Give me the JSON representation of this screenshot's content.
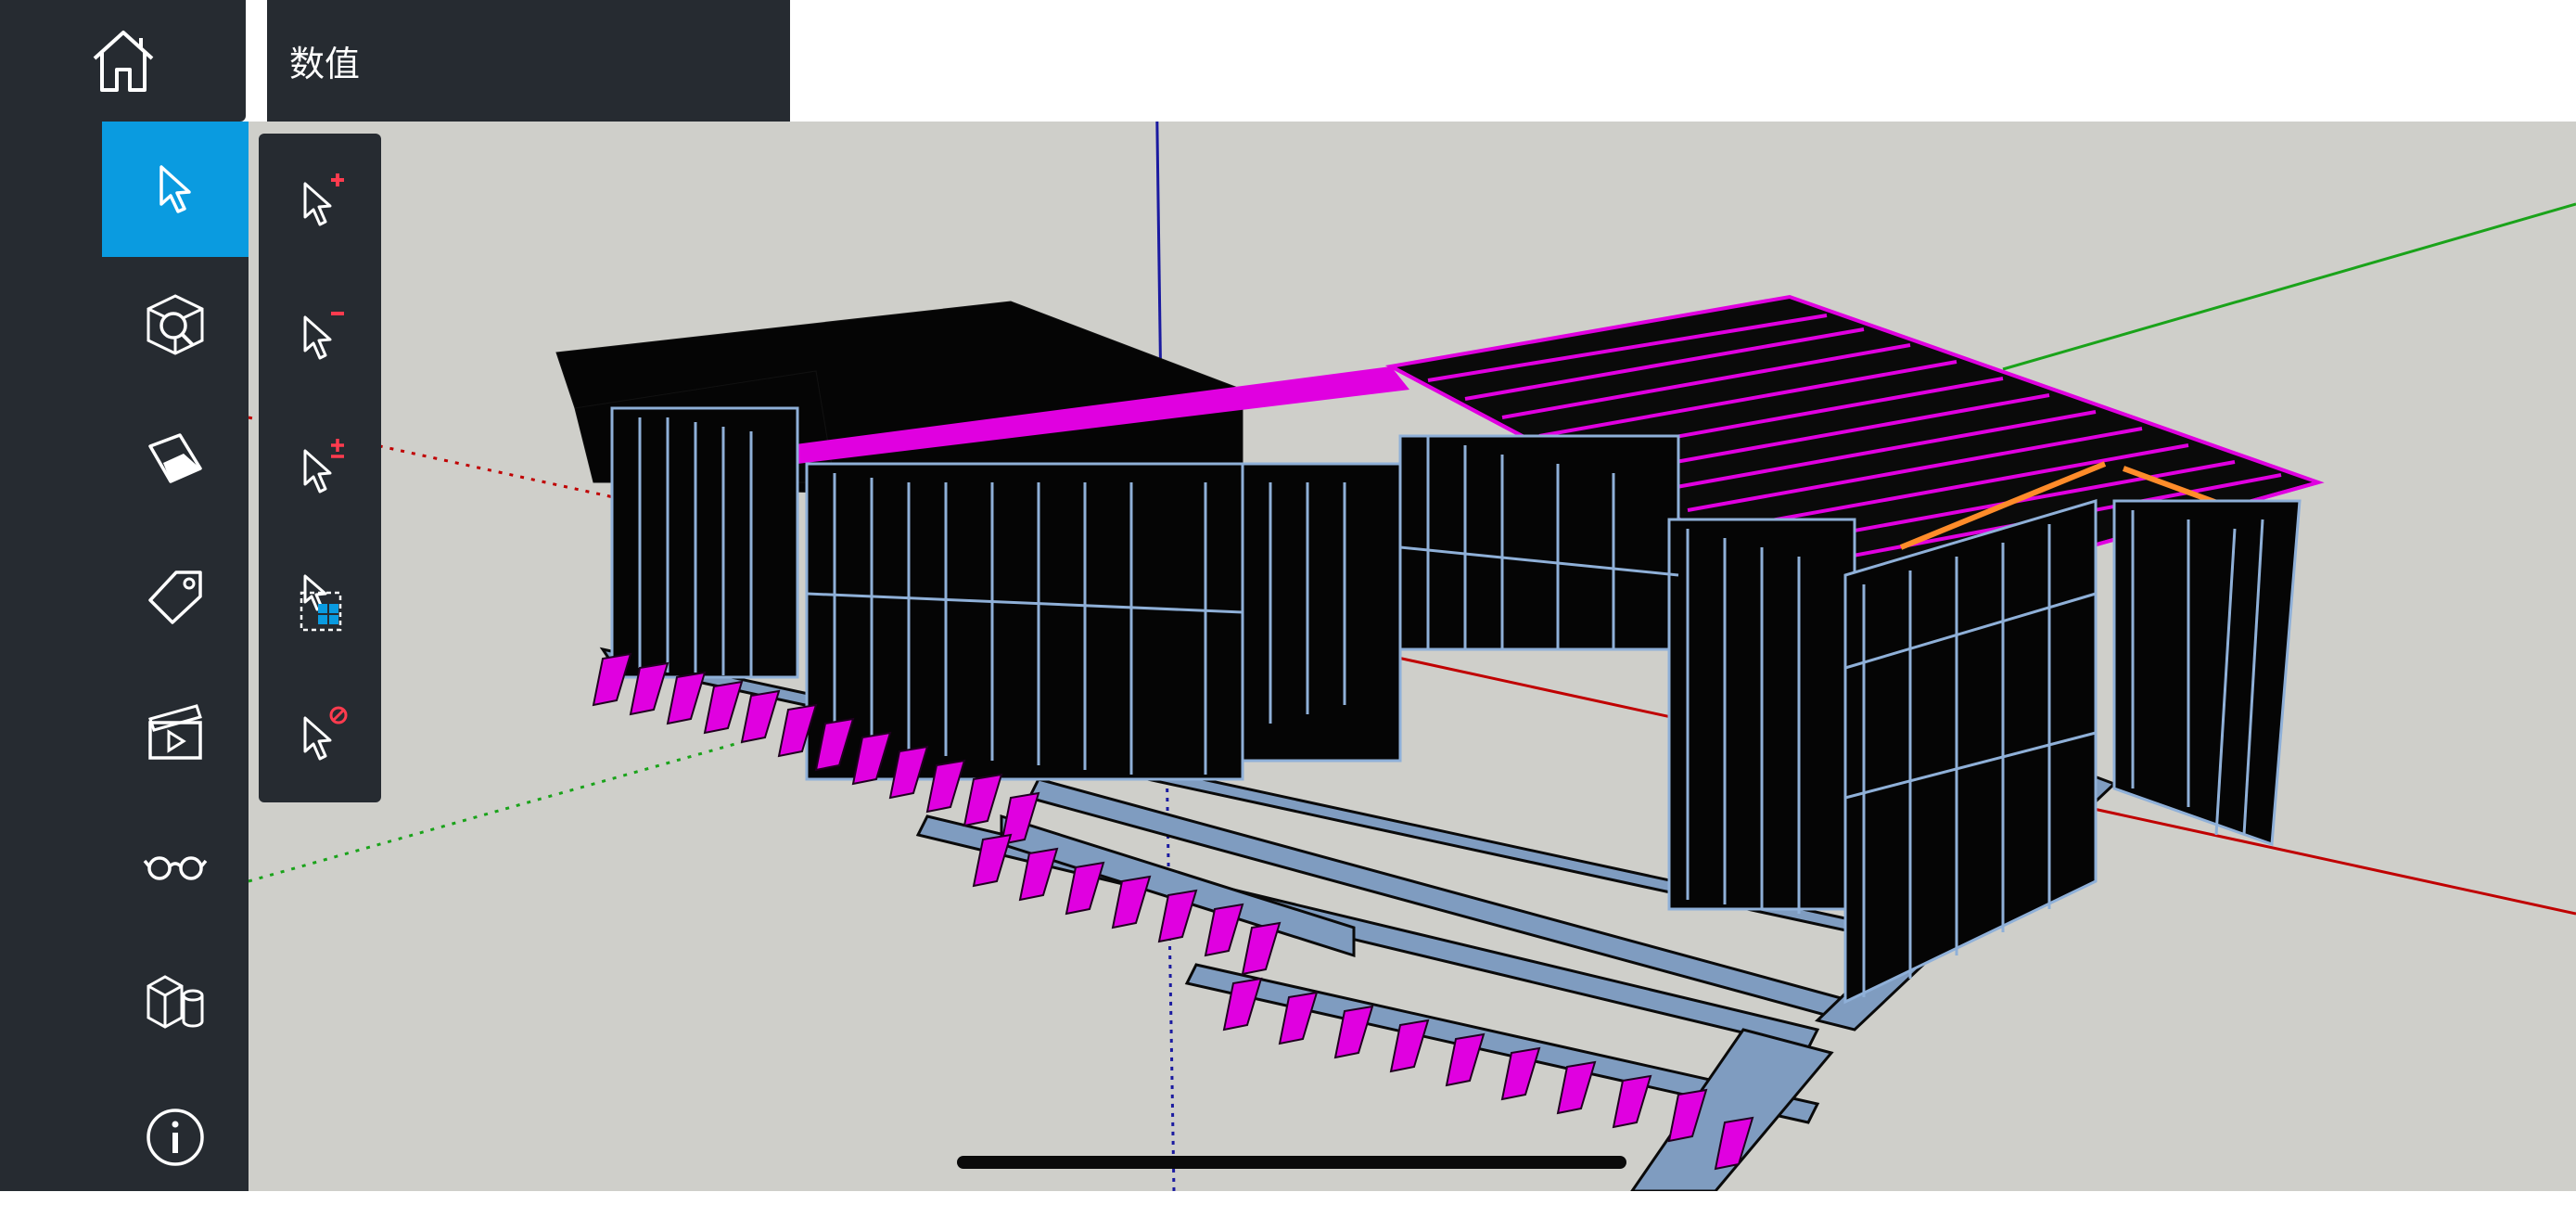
{
  "header": {
    "home_icon": "home-icon",
    "value_label": "数值"
  },
  "toolbar": {
    "tools": [
      {
        "id": "select",
        "icon": "select-arrow-icon",
        "active": true
      },
      {
        "id": "orbit",
        "icon": "search-model-icon",
        "active": false
      },
      {
        "id": "eraser",
        "icon": "eraser-icon",
        "active": false
      },
      {
        "id": "tag",
        "icon": "tag-icon",
        "active": false
      },
      {
        "id": "scenes",
        "icon": "clapperboard-icon",
        "active": false
      },
      {
        "id": "view",
        "icon": "glasses-icon",
        "active": false
      },
      {
        "id": "components",
        "icon": "components-icon",
        "active": false
      },
      {
        "id": "info",
        "icon": "info-icon",
        "active": false
      }
    ]
  },
  "select_submenu": {
    "items": [
      {
        "id": "add-to-selection",
        "icon": "select-add-icon",
        "symbol": "+"
      },
      {
        "id": "subtract-from-selection",
        "icon": "select-subtract-icon",
        "symbol": "−"
      },
      {
        "id": "toggle-selection",
        "icon": "select-toggle-icon",
        "symbol": "±"
      },
      {
        "id": "select-window",
        "icon": "select-window-icon",
        "symbol": ""
      },
      {
        "id": "clear-selection",
        "icon": "select-clear-icon",
        "symbol": "⊘"
      }
    ]
  },
  "colors": {
    "toolbar_bg": "#262b31",
    "active_blue": "#0a9be0",
    "viewport_bg": "#cfcfca",
    "axis_red": "#c00000",
    "axis_green": "#1aa31a",
    "axis_blue": "#1a1aa0",
    "highlight_magenta": "#e000e0",
    "steel": "#8fb0d8"
  }
}
